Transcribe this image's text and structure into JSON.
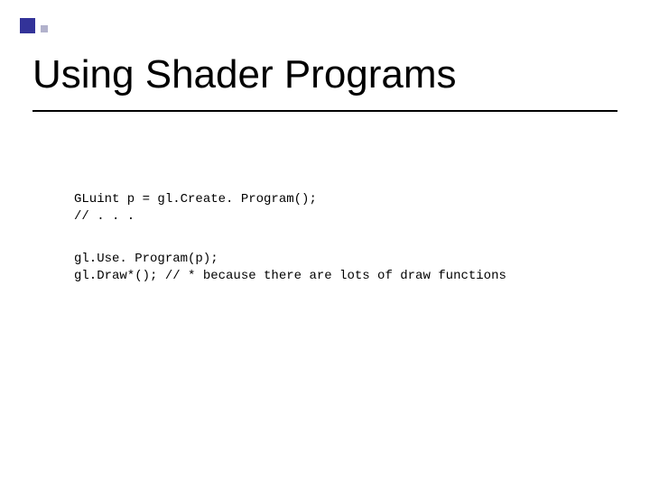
{
  "title": "Using Shader Programs",
  "code_block_1": "GLuint p = gl.Create. Program();\n// . . .",
  "code_block_2": "gl.Use. Program(p);\ngl.Draw*(); // * because there are lots of draw functions"
}
